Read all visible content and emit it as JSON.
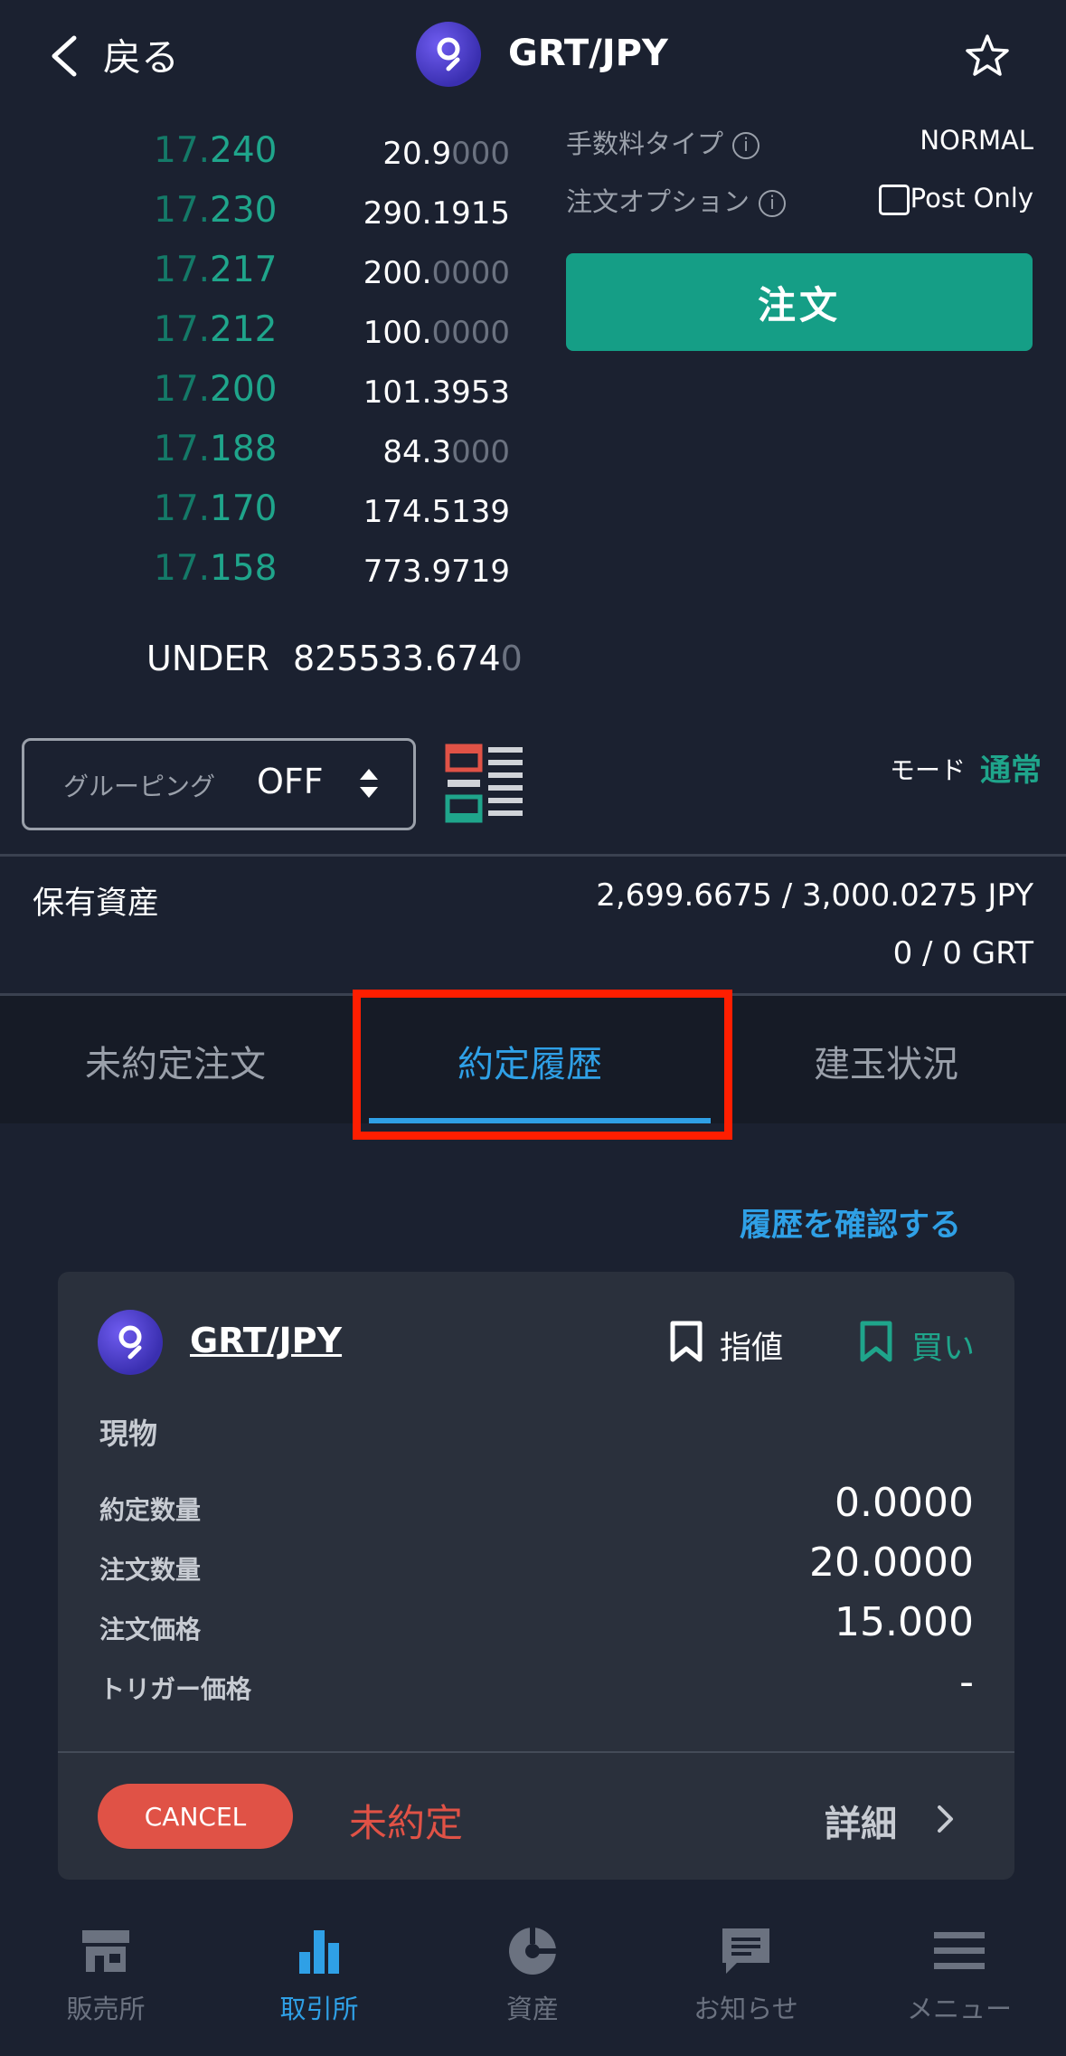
{
  "header": {
    "back_label": "戻る",
    "pair": "GRT/JPY"
  },
  "order_book": [
    {
      "price_main": "17.",
      "price_sub": "240",
      "qty_main": "20.9",
      "qty_dim": "000"
    },
    {
      "price_main": "17.",
      "price_sub": "230",
      "qty_main": "290.1915",
      "qty_dim": ""
    },
    {
      "price_main": "17.",
      "price_sub": "217",
      "qty_main": "200.",
      "qty_dim": "0000"
    },
    {
      "price_main": "17.",
      "price_sub": "212",
      "qty_main": "100.",
      "qty_dim": "0000"
    },
    {
      "price_main": "17.",
      "price_sub": "200",
      "qty_main": "101.3953",
      "qty_dim": ""
    },
    {
      "price_main": "17.",
      "price_sub": "188",
      "qty_main": "84.3",
      "qty_dim": "000"
    },
    {
      "price_main": "17.",
      "price_sub": "170",
      "qty_main": "174.5139",
      "qty_dim": ""
    },
    {
      "price_main": "17.",
      "price_sub": "158",
      "qty_main": "773.9719",
      "qty_dim": ""
    }
  ],
  "under": {
    "label": "UNDER",
    "value_main": "825533.674",
    "value_dim": "0"
  },
  "order_panel": {
    "fee_type_label": "手数料タイプ",
    "fee_type_value": "NORMAL",
    "option_label": "注文オプション",
    "post_only_label": "Post Only",
    "order_button": "注文",
    "info_glyph": "i"
  },
  "grouping": {
    "label": "グルーピング",
    "value": "OFF"
  },
  "mode": {
    "label": "モード",
    "value": "通常"
  },
  "assets": {
    "label": "保有資産",
    "jpy": "2,699.6675 / 3,000.0275  JPY",
    "grt": "0 / 0  GRT"
  },
  "tabs": [
    {
      "label": "未約定注文"
    },
    {
      "label": "約定履歴"
    },
    {
      "label": "建玉状況"
    }
  ],
  "history_link": "履歴を確認する",
  "order_card": {
    "pair": "GRT/JPY",
    "order_type": "指値",
    "side": "買い",
    "category": "現物",
    "rows": [
      {
        "label": "約定数量",
        "value": "0.0000"
      },
      {
        "label": "注文数量",
        "value": "20.0000"
      },
      {
        "label": "注文価格",
        "value": "15.000"
      },
      {
        "label": "トリガー価格",
        "value": "-"
      }
    ],
    "cancel_button": "CANCEL",
    "status": "未約定",
    "detail_label": "詳細"
  },
  "bottom_nav": [
    {
      "label": "販売所",
      "icon": "store-icon",
      "color": "#6b7280"
    },
    {
      "label": "取引所",
      "icon": "bar-chart-icon",
      "color": "#2fa0e6"
    },
    {
      "label": "資産",
      "icon": "pie-icon",
      "color": "#6b7280"
    },
    {
      "label": "お知らせ",
      "icon": "message-icon",
      "color": "#6b7280"
    },
    {
      "label": "メニュー",
      "icon": "hamburger-icon",
      "color": "#6b7280"
    }
  ],
  "colors": {
    "background": "#1b2130",
    "accent_green": "#1fa58b",
    "accent_blue": "#2fa0e6",
    "danger": "#e05246",
    "highlight": "#ff1e00"
  }
}
